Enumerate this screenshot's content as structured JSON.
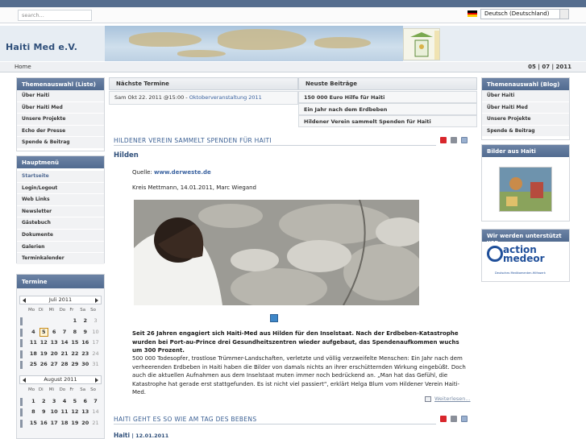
{
  "header": {
    "search_placeholder": "search...",
    "language": "Deutsch (Deutschland)",
    "site_title": "Haiti Med e.V.",
    "breadcrumb": "Home",
    "date": "05 | 07 | 2011"
  },
  "left": {
    "themes_title": "Themenauswahl (Liste)",
    "themes": [
      "Über Haiti",
      "Über Haiti Med",
      "Unsere Projekte",
      "Echo der Presse",
      "Spende & Beitrag"
    ],
    "main_title": "Hauptmenü",
    "main": [
      "Startseite",
      "Login/Logout",
      "Web Links",
      "Newsletter",
      "Gästebuch",
      "Dokumente",
      "Galerien",
      "Terminkalender"
    ],
    "calendar_title": "Termine",
    "cal1_month": "Juli 2011",
    "cal2_month": "August 2011",
    "dow": [
      "Mo",
      "Di",
      "Mi",
      "Do",
      "Fr",
      "Sa",
      "So"
    ],
    "cal1_rows": [
      [
        "",
        "",
        "",
        "",
        "1",
        "2",
        "3"
      ],
      [
        "4",
        "5",
        "6",
        "7",
        "8",
        "9",
        "10"
      ],
      [
        "11",
        "12",
        "13",
        "14",
        "15",
        "16",
        "17"
      ],
      [
        "18",
        "19",
        "20",
        "21",
        "22",
        "23",
        "24"
      ],
      [
        "25",
        "26",
        "27",
        "28",
        "29",
        "30",
        "31"
      ]
    ],
    "cal2_rows": [
      [
        "1",
        "2",
        "3",
        "4",
        "5",
        "6",
        "7"
      ],
      [
        "8",
        "9",
        "10",
        "11",
        "12",
        "13",
        "14"
      ],
      [
        "15",
        "16",
        "17",
        "18",
        "19",
        "20",
        "21"
      ]
    ]
  },
  "center": {
    "events_tab": "Nächste Termine",
    "event_date": "Sam Okt 22. 2011 @15:00 -",
    "event_link": "Oktoberveranstaltung 2011",
    "posts_tab": "Neuste Beiträge",
    "posts": [
      "150 000 Euro Hilfe für Haiti",
      "Ein Jahr nach dem Erdbeben",
      "Hildener Verein sammelt Spenden für Haiti"
    ],
    "article1": {
      "heading": "HILDENER VEREIN SAMMELT SPENDEN FÜR HAITI",
      "subtitle": "Hilden",
      "source_label": "Quelle:",
      "source_link": "www.derweste.de",
      "byline": "Kreis Mettmann, 14.01.2011, Marc Wiegand",
      "lead": "Seit 26 Jahren engagiert sich Haiti-Med aus Hilden für den Inselstaat. Nach der Erdbeben-Katastrophe wurden bei Port-au-Prince drei Gesundheitszentren wieder aufgebaut, das Spendenaufkommen wuchs um 300 Prozent.",
      "body": "500 000 Todesopfer, trostlose Trümmer-Landschaften, verletzte und völlig verzweifelte Menschen: Ein Jahr nach dem verheerenden Erdbeben in Haiti haben die Bilder von damals nichts an ihrer erschütternden Wirkung eingebüßt. Doch auch die aktuellen Aufnahmen aus dem Inselstaat muten immer noch bedrückend an. „Man hat das Gefühl, die Katastrophe hat gerade erst stattgefunden. Es ist nicht viel passiert“, erklärt Helga Blum vom Hildener Verein Haiti-Med.",
      "more": "Weiterlesen..."
    },
    "article2": {
      "heading": "HAITI GEHT ES SO WIE AM TAG DES BEBENS",
      "subtitle": "Haiti",
      "date": "| 12.01.2011"
    }
  },
  "right": {
    "themes_title": "Themenauswahl (Blog)",
    "themes": [
      "Über Haiti",
      "Über Haiti Med",
      "Unsere Projekte",
      "Spende & Beitrag"
    ],
    "pictures_title": "Bilder aus Haiti",
    "supporters_title": "Wir werden unterstützt von",
    "sponsor_line1": "action",
    "sponsor_line2": "medeor",
    "sponsor_tag": "Deutsches Medikamenten-Hilfswerk"
  },
  "colors": {
    "accent": "#516b90",
    "link": "#3a62a0",
    "brand": "#2f4f7a",
    "sponsor": "#1f4f9a"
  }
}
